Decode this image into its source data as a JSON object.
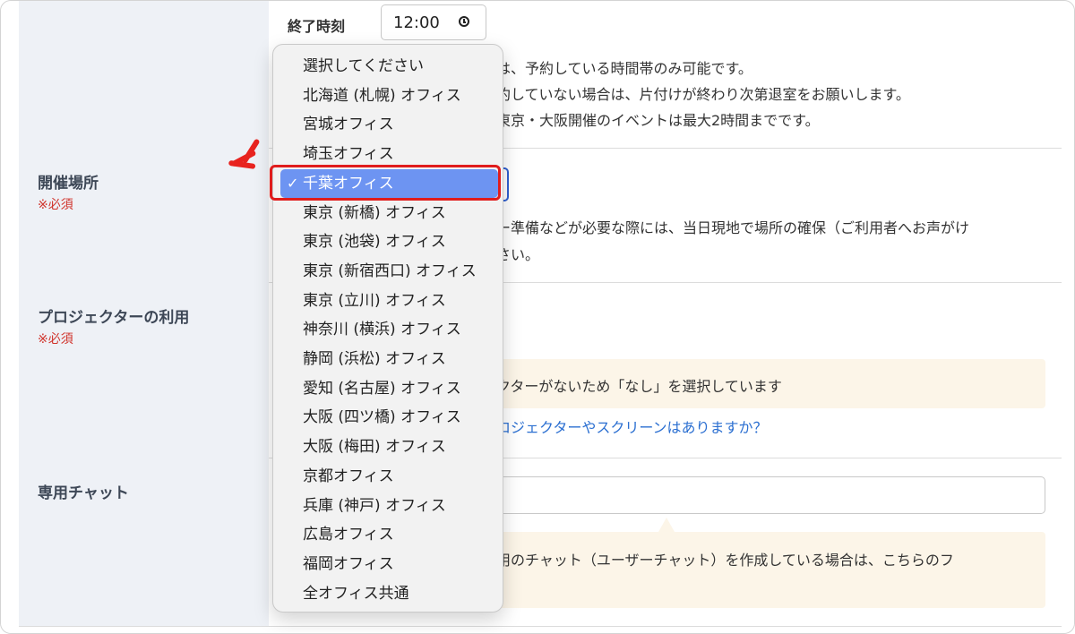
{
  "end_time": {
    "label": "終了時刻",
    "value": "12:00"
  },
  "end_time_notes": [
    "は、予約している時間帯のみ可能です。",
    "約していない場合は、片付けが終わり次第退室をお願いします。",
    "東京・大阪開催のイベントは最大2時間までです。"
  ],
  "venue": {
    "label": "開催場所",
    "required": "※必須",
    "notes": [
      "ー準備などが必要な際には、当日現地で場所の確保（ご利用者へお声がけ",
      "さい。"
    ]
  },
  "projector": {
    "label": "プロジェクターの利用",
    "required": "※必須",
    "notice": "クターがないため「なし」を選択しています",
    "link": "ロジェクターやスクリーンはありますか？"
  },
  "chat": {
    "label": "専用チャット",
    "input_value": "",
    "notice_lines": [
      "用のチャット（ユーザーチャット）を作成している場合は、こちらのフ"
    ]
  },
  "dropdown": {
    "selected_index": 4,
    "check_mark": "✓",
    "options": [
      "選択してください",
      "北海道 (札幌) オフィス",
      "宮城オフィス",
      "埼玉オフィス",
      "千葉オフィス",
      "東京 (新橋) オフィス",
      "東京 (池袋) オフィス",
      "東京 (新宿西口) オフィス",
      "東京 (立川) オフィス",
      "神奈川 (横浜) オフィス",
      "静岡 (浜松) オフィス",
      "愛知 (名古屋) オフィス",
      "大阪 (四ツ橋) オフィス",
      "大阪 (梅田) オフィス",
      "京都オフィス",
      "兵庫 (神戸) オフィス",
      "広島オフィス",
      "福岡オフィス",
      "全オフィス共通"
    ]
  },
  "colors": {
    "label_bg": "#eef1f6",
    "required_red": "#d0342c",
    "link_blue": "#2b6fd1",
    "notice_bg": "#fcf5e8",
    "highlight_blue": "#6d94f2",
    "annotation_red": "#e01c1c"
  }
}
